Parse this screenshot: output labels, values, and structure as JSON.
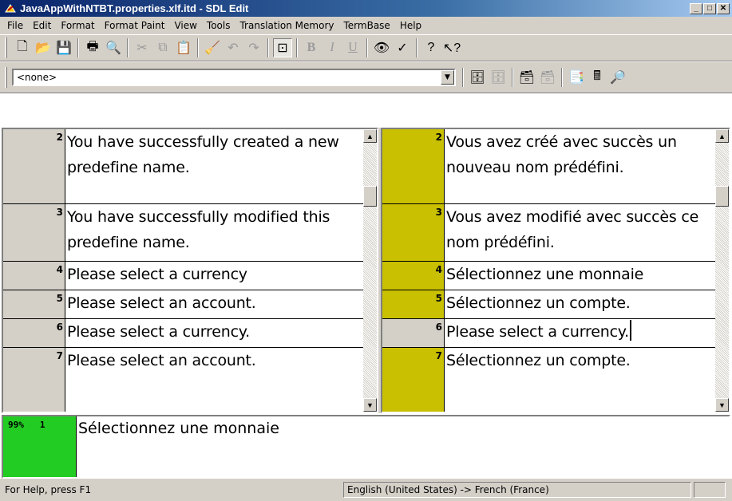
{
  "window": {
    "title": "JavaAppWithNTBT.properties.xlf.itd - SDL Edit"
  },
  "menu": [
    "File",
    "Edit",
    "Format",
    "Format Paint",
    "View",
    "Tools",
    "Translation Memory",
    "TermBase",
    "Help"
  ],
  "filter": {
    "value": "<none>"
  },
  "source_segments": [
    {
      "num": "2",
      "text": "You have successfully created a new predefine name."
    },
    {
      "num": "3",
      "text": "You have successfully modified this predefine name."
    },
    {
      "num": "4",
      "text": "Please select a currency"
    },
    {
      "num": "5",
      "text": "Please select an account."
    },
    {
      "num": "6",
      "text": "Please select a currency."
    },
    {
      "num": "7",
      "text": "Please select an account."
    }
  ],
  "target_segments": [
    {
      "num": "2",
      "text": "Vous avez créé avec succès un nouveau nom prédéfini.",
      "translated": true
    },
    {
      "num": "3",
      "text": "Vous avez modifié avec succès ce nom prédéfini.",
      "translated": true
    },
    {
      "num": "4",
      "text": "Sélectionnez une monnaie",
      "translated": true
    },
    {
      "num": "5",
      "text": "Sélectionnez un compte.",
      "translated": true
    },
    {
      "num": "6",
      "text": "Please select a currency.",
      "translated": false
    },
    {
      "num": "7",
      "text": "Sélectionnez un compte.",
      "translated": true
    }
  ],
  "tm_match": {
    "score": "99%",
    "num": "1",
    "text": "Sélectionnez une monnaie"
  },
  "status": {
    "help": "For Help, press F1",
    "language": "English (United States) -> French (France)"
  },
  "colors": {
    "translated": "#c8c000",
    "match": "#22cc22"
  }
}
